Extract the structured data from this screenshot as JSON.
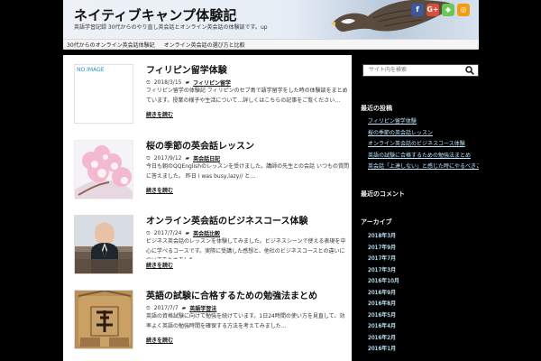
{
  "header": {
    "site_title": "ネイティブキャンプ体験記",
    "site_description": "英語学習記録 30代からのやり直し英会話とオンライン英会話の体験談です。up"
  },
  "social": {
    "facebook_label": "f",
    "google_label": "G+",
    "feedly_label": "◆",
    "rss_label": "◎",
    "colors": {
      "facebook": "#3b5998",
      "google": "#dd4b39",
      "feedly": "#6cc655",
      "rss": "#f39c12"
    }
  },
  "nav": {
    "items": [
      "30代からのオンライン英会話体験記",
      "オンライン英会話の選び方と比較"
    ]
  },
  "posts": [
    {
      "title": "フィリピン留学体験",
      "date": "2018/3/15",
      "category": "フィリピン留学",
      "excerpt": "フィリピン留学の体験記 フィリピンのセブ島で語学留学をした時の体験談をまとめています。授業の様子や生活について…詳しくはこちらの記事をご覧ください…",
      "more": "続きを読む",
      "thumb_label": "NO IMAGE",
      "thumb_type": "noimage"
    },
    {
      "title": "桜の季節の英会話レッスン",
      "date": "2017/9/12",
      "category": "英会話日記",
      "excerpt": "今日も朝のQQEnglishのレッスンを受けました。講師の先生との会話 いつもの質問に答えました。 昨日 I was busy,lazy// と…",
      "more": "続きを読む",
      "thumb_type": "sakura"
    },
    {
      "title": "オンライン英会話のビジネスコース体験",
      "date": "2017/7/24",
      "category": "英会話比較",
      "excerpt": "ビジネス英会話のレッスンを体験してみました。ビジネスシーンで使える表現を中心に学べるコースです。実際に受講した感想と、他社のビジネスコースとの違いについてまとめました…",
      "more": "続きを読む",
      "thumb_type": "business"
    },
    {
      "title": "英語の試験に合格するための勉強法まとめ",
      "date": "2017/7/7",
      "category": "英語学習法",
      "excerpt": "英語の資格試験に向けて勉強を続けています。1日24時間の使い方を見直して、効率よく英語の勉強時間を確保する方法を考えてみました…",
      "more": "続きを読む",
      "thumb_type": "ema"
    }
  ],
  "sidebar": {
    "search_placeholder": "サイト内を検索",
    "recent_title": "最近の投稿",
    "recent_items": [
      "フィリピン留学体験",
      "桜の季節の英会話レッスン",
      "オンライン英会話のビジネスコース体験",
      "英語の試験に合格するための勉強法まとめ",
      "英会話「上達しない」と感じた時にやるべきこと"
    ],
    "comments_title": "最近のコメント",
    "archive_title": "アーカイブ",
    "archive_items": [
      "2018年3月",
      "2017年9月",
      "2017年7月",
      "2017年3月",
      "2016年10月",
      "2016年9月",
      "2016年8月",
      "2016年5月",
      "2016年4月",
      "2016年2月",
      "2016年1月"
    ]
  }
}
